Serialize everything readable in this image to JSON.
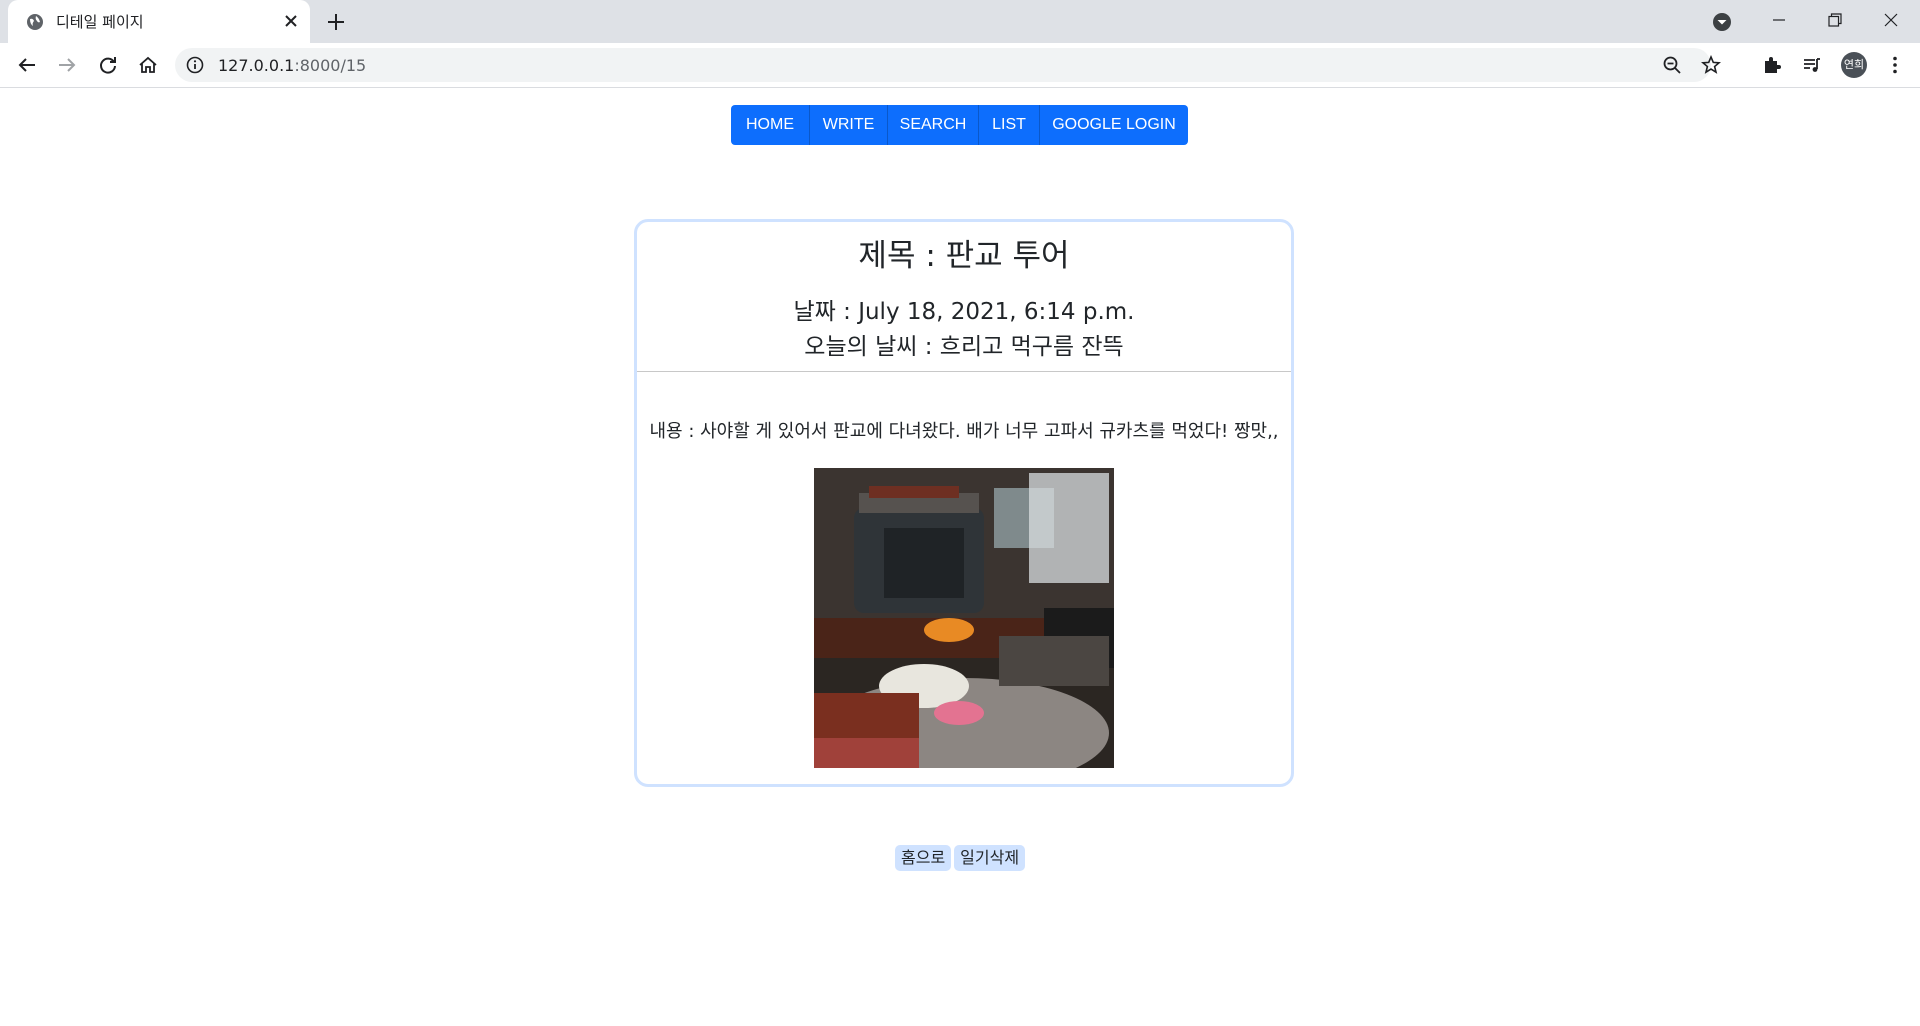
{
  "browser": {
    "tab_title": "디테일 페이지",
    "url_host": "127.0.0.1",
    "url_path": ":8000/15",
    "profile_initials": "연희"
  },
  "nav": {
    "items": [
      "HOME",
      "WRITE",
      "SEARCH",
      "LIST",
      "GOOGLE LOGIN"
    ]
  },
  "diary": {
    "title": "제목 : 판교 투어",
    "date": "날짜 : July 18, 2021, 6:14 p.m.",
    "weather": "오늘의 날씨 : 흐리고 먹구름 잔뜩",
    "content": "내용 : 사야할 게 있어서 판교에 다녀왔다. 배가 너무 고파서 규카츠를 먹었다! 짱맛,,"
  },
  "actions": {
    "home_label": "홈으로",
    "delete_label": "일기삭제"
  },
  "colors": {
    "nav_button": "#0d6efd",
    "card_border": "#cfe2ff",
    "action_button": "#cfe2ff"
  }
}
